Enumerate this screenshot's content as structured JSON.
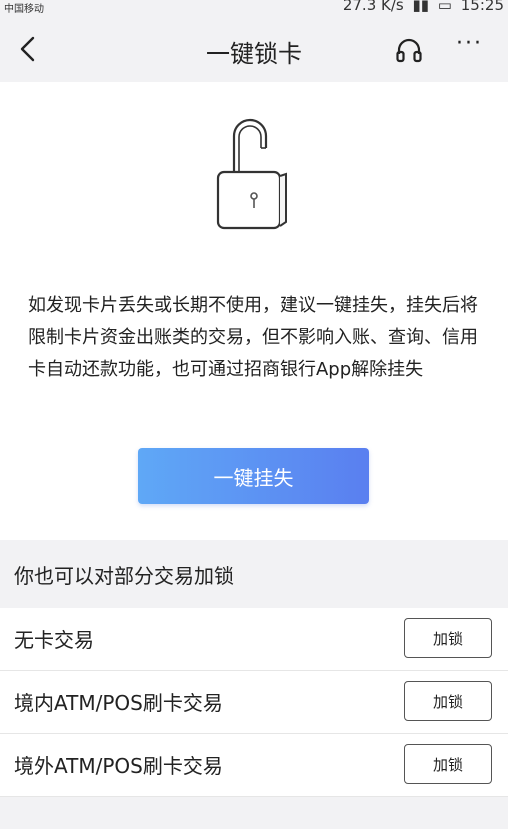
{
  "status_bar": {
    "carrier": "中国移动",
    "speed": "27.3 K/s",
    "time": "15:25"
  },
  "nav": {
    "title": "一键锁卡",
    "back_icon": "chevron-left-icon",
    "service_icon": "headset-icon",
    "more_label": "···"
  },
  "hero": {
    "lock_icon": "padlock-open-icon",
    "description": "如发现卡片丢失或长期不使用，建议一键挂失，挂失后将限制卡片资金出账类的交易，但不影响入账、查询、信用卡自动还款功能，也可通过招商银行App解除挂失",
    "report_loss_button": "一键挂失"
  },
  "partial_lock": {
    "section_title": "你也可以对部分交易加锁",
    "items": [
      {
        "label": "无卡交易",
        "button": "加锁"
      },
      {
        "label": "境内ATM/POS刷卡交易",
        "button": "加锁"
      },
      {
        "label": "境外ATM/POS刷卡交易",
        "button": "加锁"
      }
    ]
  },
  "colors": {
    "button_gradient_start": "#5fa8f6",
    "button_gradient_end": "#5a7ff0",
    "page_bg": "#f2f2f4"
  }
}
